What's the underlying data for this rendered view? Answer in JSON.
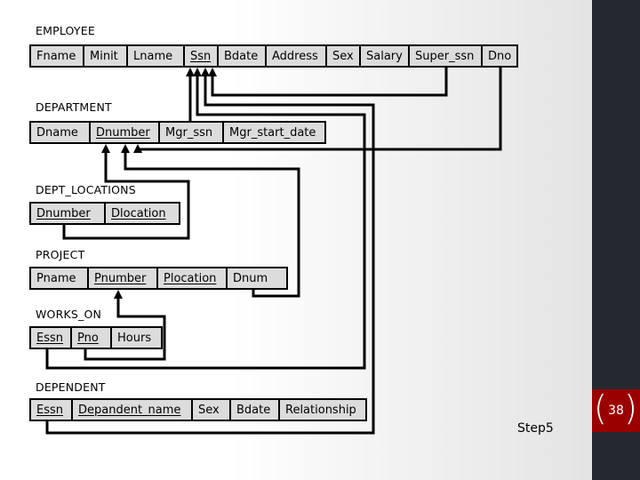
{
  "relations": [
    {
      "id": "employee",
      "title": "EMPLOYEE",
      "attributes": [
        {
          "name": "Fname",
          "pk": false
        },
        {
          "name": "Minit",
          "pk": false
        },
        {
          "name": "Lname",
          "pk": false
        },
        {
          "name": "Ssn",
          "pk": true
        },
        {
          "name": "Bdate",
          "pk": false
        },
        {
          "name": "Address",
          "pk": false
        },
        {
          "name": "Sex",
          "pk": false
        },
        {
          "name": "Salary",
          "pk": false
        },
        {
          "name": "Super_ssn",
          "pk": false
        },
        {
          "name": "Dno",
          "pk": false
        }
      ]
    },
    {
      "id": "department",
      "title": "DEPARTMENT",
      "attributes": [
        {
          "name": "Dname",
          "pk": false
        },
        {
          "name": "Dnumber",
          "pk": true
        },
        {
          "name": "Mgr_ssn",
          "pk": false
        },
        {
          "name": "Mgr_start_date",
          "pk": false
        }
      ]
    },
    {
      "id": "dept_locations",
      "title": "DEPT_LOCATIONS",
      "attributes": [
        {
          "name": "Dnumber",
          "pk": true
        },
        {
          "name": "Dlocation",
          "pk": true
        }
      ]
    },
    {
      "id": "project",
      "title": "PROJECT",
      "attributes": [
        {
          "name": "Pname",
          "pk": false
        },
        {
          "name": "Pnumber",
          "pk": true
        },
        {
          "name": "Plocation",
          "pk": true
        },
        {
          "name": "Dnum",
          "pk": false
        }
      ]
    },
    {
      "id": "works_on",
      "title": "WORKS_ON",
      "attributes": [
        {
          "name": "Essn",
          "pk": true
        },
        {
          "name": "Pno",
          "pk": true
        },
        {
          "name": "Hours",
          "pk": false
        }
      ]
    },
    {
      "id": "dependent",
      "title": "DEPENDENT",
      "attributes": [
        {
          "name": "Essn",
          "pk": true
        },
        {
          "name": "Depandent_name",
          "pk": true
        },
        {
          "name": "Sex",
          "pk": false
        },
        {
          "name": "Bdate",
          "pk": false
        },
        {
          "name": "Relationship",
          "pk": false
        }
      ]
    }
  ],
  "foreign_keys": [
    {
      "from": "EMPLOYEE.Super_ssn",
      "to": "EMPLOYEE.Ssn"
    },
    {
      "from": "EMPLOYEE.Dno",
      "to": "DEPARTMENT.Dnumber"
    },
    {
      "from": "DEPARTMENT.Mgr_ssn",
      "to": "EMPLOYEE.Ssn"
    },
    {
      "from": "DEPT_LOCATIONS.Dnumber",
      "to": "DEPARTMENT.Dnumber"
    },
    {
      "from": "PROJECT.Dnum",
      "to": "DEPARTMENT.Dnumber"
    },
    {
      "from": "WORKS_ON.Essn",
      "to": "EMPLOYEE.Ssn"
    },
    {
      "from": "WORKS_ON.Pno",
      "to": "PROJECT.Pnumber"
    },
    {
      "from": "DEPENDENT.Essn",
      "to": "EMPLOYEE.Ssn"
    }
  ],
  "step_label": "Step5",
  "page_number": "38",
  "colors": {
    "cell_fill": "#dcdcdc",
    "accent": "#9b0000",
    "band": "#262830"
  }
}
